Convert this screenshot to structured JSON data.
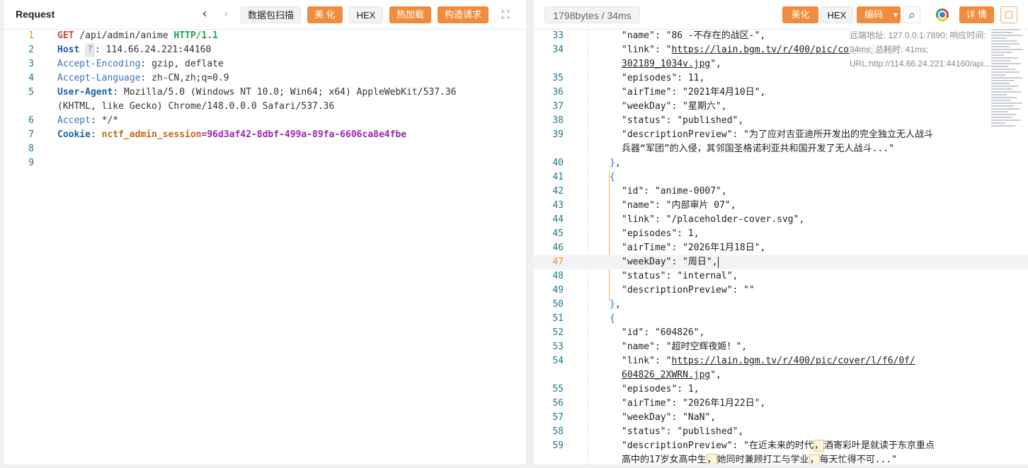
{
  "request": {
    "title": "Request",
    "back_glyph": "‹",
    "forward_glyph": "›",
    "buttons": {
      "scan": "数据包扫描",
      "beautify": "美 化",
      "hex": "HEX",
      "hot_load": "热加载",
      "construct": "构造请求"
    },
    "fullscreen_glyph": "⛶",
    "lines": [
      {
        "n": "1",
        "method": "GET",
        "path": " /api/admin/anime ",
        "proto": "HTTP/1.1"
      },
      {
        "n": "2",
        "key": "Host",
        "badge": "?",
        "sep": ": ",
        "value": "114.66.24.221:44160"
      },
      {
        "n": "3",
        "hkey": "Accept-Encoding",
        "sep": ": ",
        "value": "gzip, deflate"
      },
      {
        "n": "4",
        "hkey": "Accept-Language",
        "sep": ": ",
        "value": "zh-CN,zh;q=0.9"
      },
      {
        "n": "5",
        "key": "User-Agent",
        "sep": ": ",
        "value": "Mozilla/5.0 (Windows NT 10.0; Win64; x64) AppleWebKit/537.36"
      },
      {
        "n": "",
        "value": "(KHTML, like Gecko) Chrome/148.0.0.0 Safari/537.36"
      },
      {
        "n": "6",
        "hkey": "Accept",
        "sep": ": ",
        "value": "*/*"
      },
      {
        "n": "7",
        "key": "Cookie",
        "sep": ": ",
        "ckey": "nctf_admin_session",
        "eq": "=",
        "cval": "96d3af42-8dbf-499a-89fa-6606ca8e4fbe"
      },
      {
        "n": "8"
      },
      {
        "n": "9"
      }
    ]
  },
  "response": {
    "size_label": "1798bytes / 34ms",
    "buttons": {
      "beautify": "美化",
      "hex": "HEX",
      "encoding": "编码",
      "details": "详 情"
    },
    "dropdown_glyph": "▾",
    "search_glyph": "⌕",
    "chat_glyph": "☐",
    "tooltip": "远端地址: 127.0.0.1:7890; 响应时间: 34ms; 总耗时: 41ms; URL:http://114.66.24.221:44160/api...",
    "lines": [
      {
        "n": "33",
        "indent": 1,
        "text": "\"name\": \"86 -不存在的战区-\","
      },
      {
        "n": "34",
        "indent": 1,
        "pre": "\"link\": \"",
        "link": "https://lain.bgm.tv/r/400/pic/cover/l/e4/"
      },
      {
        "n": "",
        "indent": 1,
        "link": "302189_1034v.jpg",
        "post": "\","
      },
      {
        "n": "35",
        "indent": 1,
        "text": "\"episodes\": 11,"
      },
      {
        "n": "36",
        "indent": 1,
        "text": "\"airTime\": \"2021年4月10日\","
      },
      {
        "n": "37",
        "indent": 1,
        "text": "\"weekDay\": \"星期六\","
      },
      {
        "n": "38",
        "indent": 1,
        "text": "\"status\": \"published\","
      },
      {
        "n": "39",
        "indent": 1,
        "text": "\"descriptionPreview\": \"为了应对吉亚迪所开发出的完全独立无人战斗"
      },
      {
        "n": "",
        "indent": 1,
        "text": "兵器“军团”的入侵，其邻国圣格诺利亚共和国开发了无人战斗...\""
      },
      {
        "n": "40",
        "indent": 0,
        "brace": "}",
        "text": ","
      },
      {
        "n": "41",
        "indent": 0,
        "brace": "{"
      },
      {
        "n": "42",
        "indent": 1,
        "text": "\"id\": \"anime-0007\","
      },
      {
        "n": "43",
        "indent": 1,
        "text": "\"name\": \"内部审片 07\","
      },
      {
        "n": "44",
        "indent": 1,
        "text": "\"link\": \"/placeholder-cover.svg\","
      },
      {
        "n": "45",
        "indent": 1,
        "text": "\"episodes\": 1,"
      },
      {
        "n": "46",
        "indent": 1,
        "text": "\"airTime\": \"2026年1月18日\","
      },
      {
        "n": "47",
        "indent": 1,
        "text": "\"weekDay\": \"周日\",",
        "caret": true,
        "active": true
      },
      {
        "n": "48",
        "indent": 1,
        "text": "\"status\": \"internal\","
      },
      {
        "n": "49",
        "indent": 1,
        "text": "\"descriptionPreview\": \"\""
      },
      {
        "n": "50",
        "indent": 0,
        "brace": "}",
        "text": ","
      },
      {
        "n": "51",
        "indent": 0,
        "brace": "{"
      },
      {
        "n": "52",
        "indent": 1,
        "text": "\"id\": \"604826\","
      },
      {
        "n": "53",
        "indent": 1,
        "text": "\"name\": \"超时空辉夜姬！\","
      },
      {
        "n": "54",
        "indent": 1,
        "pre": "\"link\": \"",
        "link": "https://lain.bgm.tv/r/400/pic/cover/l/f6/0f/"
      },
      {
        "n": "",
        "indent": 1,
        "link": "604826_2XWRN.jpg",
        "post": "\","
      },
      {
        "n": "55",
        "indent": 1,
        "text": "\"episodes\": 1,"
      },
      {
        "n": "56",
        "indent": 1,
        "text": "\"airTime\": \"2026年1月22日\","
      },
      {
        "n": "57",
        "indent": 1,
        "text": "\"weekDay\": \"NaN\","
      },
      {
        "n": "58",
        "indent": 1,
        "text": "\"status\": \"published\","
      },
      {
        "n": "59",
        "indent": 1,
        "segs": [
          "\"descriptionPreview\": \"在近未来的时代",
          "，",
          "酒寄彩叶是就读于东京重点"
        ]
      },
      {
        "n": "",
        "indent": 1,
        "segs": [
          "高中的17岁女高中生",
          "，",
          "她同时兼顾打工与学业",
          "，",
          "每天忙得不可...\""
        ]
      }
    ]
  }
}
